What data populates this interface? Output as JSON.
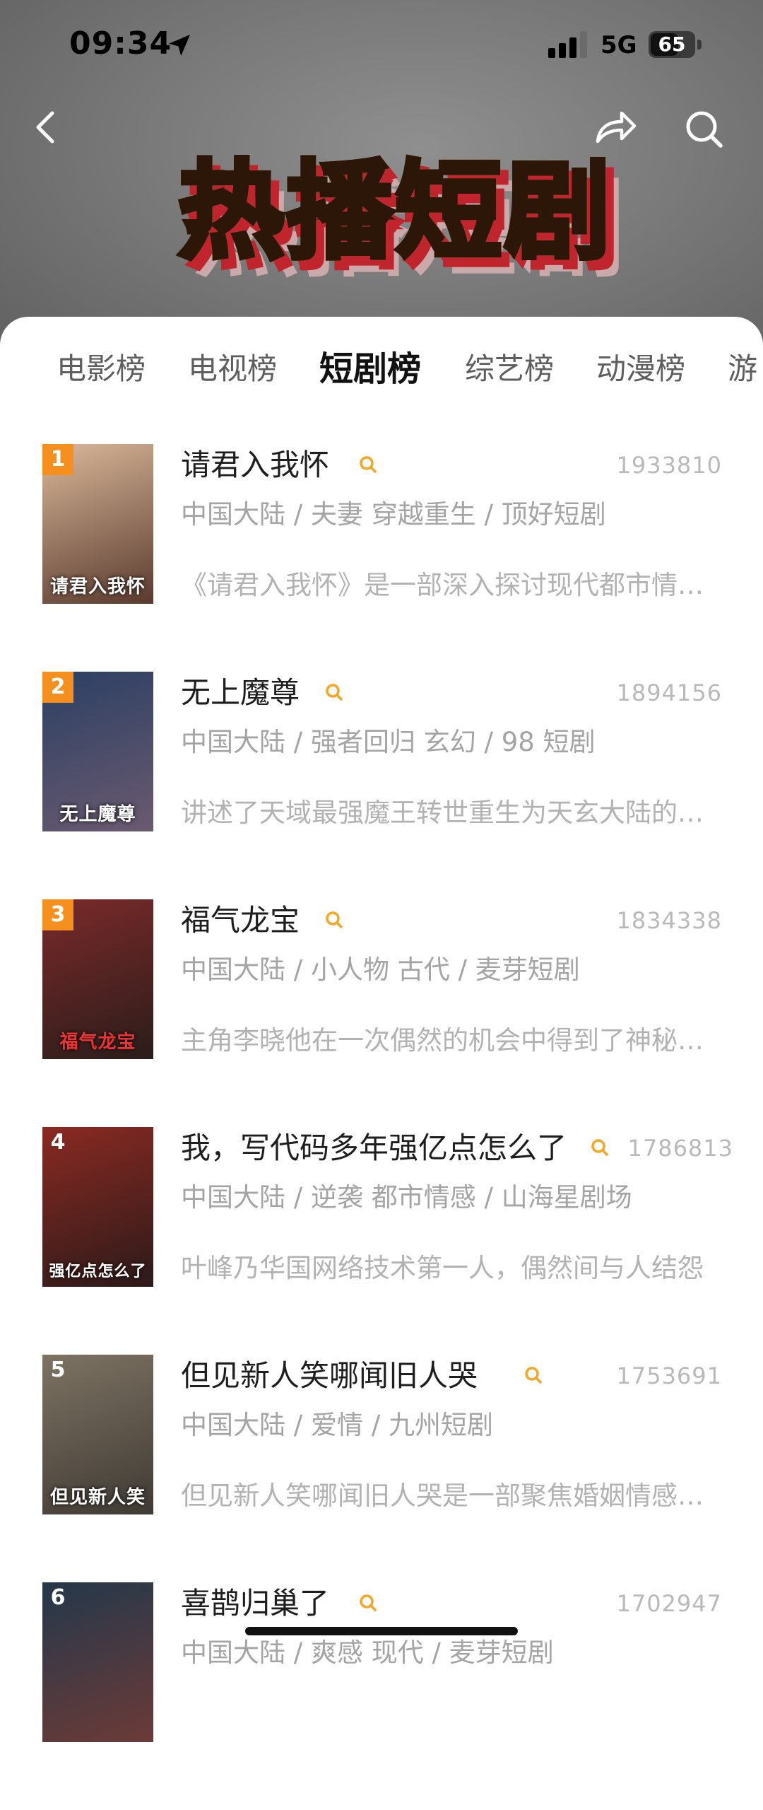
{
  "status_bar": {
    "time": "09:34",
    "network": "5G",
    "battery_percent": 65,
    "battery_label": "65"
  },
  "header": {
    "banner_title": "热播短剧"
  },
  "tabs": [
    {
      "label": "电影榜",
      "active": false
    },
    {
      "label": "电视榜",
      "active": false
    },
    {
      "label": "短剧榜",
      "active": true
    },
    {
      "label": "综艺榜",
      "active": false
    },
    {
      "label": "动漫榜",
      "active": false
    },
    {
      "label": "游",
      "active": false
    }
  ],
  "list": [
    {
      "rank": "1",
      "title": "请君入我怀",
      "heat": "1933810",
      "meta": "中国大陆 / 夫妻 穿越重生 / 顶好短剧",
      "desc": "《请君入我怀》是一部深入探讨现代都市情感的短剧",
      "poster_caption": "请君入我怀",
      "rank_color": "#f5901e",
      "poster_colors": [
        "#d9b89a",
        "#5a3a2e"
      ]
    },
    {
      "rank": "2",
      "title": "无上魔尊",
      "heat": "1894156",
      "meta": "中国大陆 / 强者回归 玄幻 / 98 短剧",
      "desc": "讲述了天域最强魔王转世重生为天玄大陆的少年",
      "poster_caption": "无上魔尊",
      "rank_color": "#f5901e",
      "poster_colors": [
        "#2c3f63",
        "#6a5a6f"
      ]
    },
    {
      "rank": "3",
      "title": "福气龙宝",
      "heat": "1834338",
      "meta": "中国大陆 / 小人物 古代 / 麦芽短剧",
      "desc": "主角李晓他在一次偶然的机会中得到了神秘的力量",
      "poster_caption": "福气龙宝",
      "rank_color": "#f5901e",
      "poster_colors": [
        "#7a2a2a",
        "#2a1d1a"
      ]
    },
    {
      "rank": "4",
      "title": "我，写代码多年强亿点怎么了",
      "heat": "1786813",
      "meta": "中国大陆 / 逆袭 都市情感 / 山海星剧场",
      "desc": "叶峰乃华国网络技术第一人，偶然间与人结怨",
      "poster_caption": "强亿点怎么了",
      "rank_color": "#2a2a2a",
      "poster_colors": [
        "#8a2a22",
        "#2b1a1a"
      ]
    },
    {
      "rank": "5",
      "title": "但见新人笑哪闻旧人哭",
      "heat": "1753691",
      "meta": "中国大陆 / 爱情 / 九州短剧",
      "desc": "但见新人笑哪闻旧人哭是一部聚焦婚姻情感的短剧",
      "poster_caption": "但见新人笑",
      "rank_color": "#2a2a2a",
      "poster_colors": [
        "#7d7363",
        "#3f3a34"
      ]
    },
    {
      "rank": "6",
      "title": "喜鹊归巢了",
      "heat": "1702947",
      "meta": "中国大陆 / 爽感 现代 / 麦芽短剧",
      "desc": "",
      "poster_caption": "",
      "rank_color": "#2a2a2a",
      "poster_colors": [
        "#24384a",
        "#6b3b38"
      ]
    }
  ],
  "colors": {
    "accent": "#f5901e",
    "search_mark": "#f5a623"
  },
  "icons": [
    "location-arrow-icon",
    "signal-icon",
    "back-arrow-icon",
    "share-icon",
    "search-icon"
  ]
}
